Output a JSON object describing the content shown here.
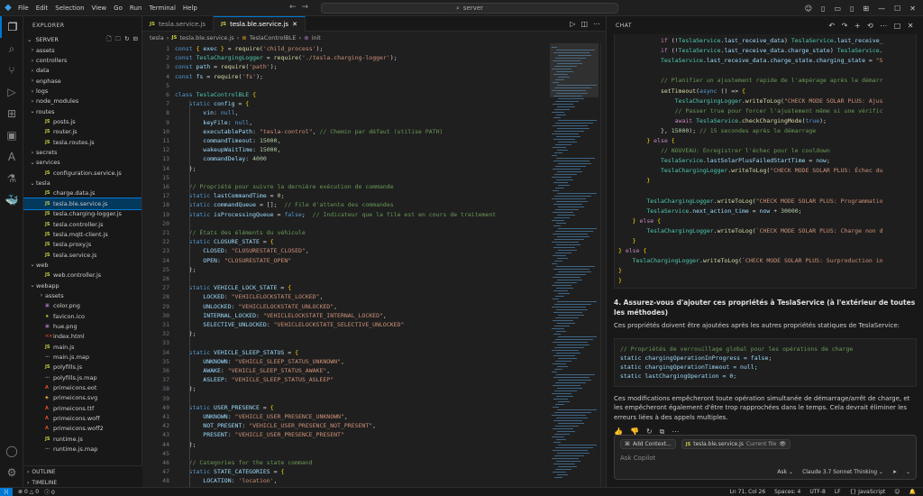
{
  "titlebar": {
    "menus": [
      "File",
      "Edit",
      "Selection",
      "View",
      "Go",
      "Run",
      "Terminal",
      "Help"
    ],
    "search": "server"
  },
  "explorer": {
    "header": "EXPLORER",
    "root": "SERVER",
    "tree": [
      {
        "name": "assets",
        "type": "folder",
        "depth": 1,
        "open": false
      },
      {
        "name": "controllers",
        "type": "folder",
        "depth": 1,
        "open": false
      },
      {
        "name": "data",
        "type": "folder",
        "depth": 1,
        "open": false
      },
      {
        "name": "enphase",
        "type": "folder",
        "depth": 1,
        "open": false
      },
      {
        "name": "logs",
        "type": "folder",
        "depth": 1,
        "open": false
      },
      {
        "name": "node_modules",
        "type": "folder",
        "depth": 1,
        "open": false
      },
      {
        "name": "routes",
        "type": "folder",
        "depth": 1,
        "open": true
      },
      {
        "name": "posts.js",
        "type": "js",
        "depth": 2
      },
      {
        "name": "router.js",
        "type": "js",
        "depth": 2
      },
      {
        "name": "tesla.routes.js",
        "type": "js",
        "depth": 2
      },
      {
        "name": "secrets",
        "type": "folder",
        "depth": 1,
        "open": false
      },
      {
        "name": "services",
        "type": "folder",
        "depth": 1,
        "open": true
      },
      {
        "name": "configuration.service.js",
        "type": "js",
        "depth": 2
      },
      {
        "name": "tesla",
        "type": "folder",
        "depth": 1,
        "open": true
      },
      {
        "name": "charge.data.js",
        "type": "js",
        "depth": 2
      },
      {
        "name": "tesla.ble.service.js",
        "type": "js",
        "depth": 2,
        "selected": true
      },
      {
        "name": "tesla.charging-logger.js",
        "type": "js",
        "depth": 2
      },
      {
        "name": "tesla.controller.js",
        "type": "js",
        "depth": 2
      },
      {
        "name": "tesla.mqtt-client.js",
        "type": "js",
        "depth": 2
      },
      {
        "name": "tesla.proxy.js",
        "type": "js",
        "depth": 2
      },
      {
        "name": "tesla.service.js",
        "type": "js",
        "depth": 2
      },
      {
        "name": "web",
        "type": "folder",
        "depth": 1,
        "open": true
      },
      {
        "name": "web.controller.js",
        "type": "js",
        "depth": 2
      },
      {
        "name": "webapp",
        "type": "folder",
        "depth": 1,
        "open": true
      },
      {
        "name": "assets",
        "type": "folder",
        "depth": 2,
        "open": false
      },
      {
        "name": "color.png",
        "type": "png",
        "depth": 2
      },
      {
        "name": "favicon.ico",
        "type": "ico",
        "depth": 2
      },
      {
        "name": "hue.png",
        "type": "png",
        "depth": 2
      },
      {
        "name": "index.html",
        "type": "html",
        "depth": 2
      },
      {
        "name": "main.js",
        "type": "js",
        "depth": 2
      },
      {
        "name": "main.js.map",
        "type": "map",
        "depth": 2
      },
      {
        "name": "polyfills.js",
        "type": "js",
        "depth": 2
      },
      {
        "name": "polyfills.js.map",
        "type": "map",
        "depth": 2
      },
      {
        "name": "primeicons.eot",
        "type": "eot",
        "depth": 2
      },
      {
        "name": "primeicons.svg",
        "type": "svg",
        "depth": 2
      },
      {
        "name": "primeicons.ttf",
        "type": "ttf",
        "depth": 2
      },
      {
        "name": "primeicons.woff",
        "type": "woff",
        "depth": 2
      },
      {
        "name": "primeicons.woff2",
        "type": "woff",
        "depth": 2
      },
      {
        "name": "runtime.js",
        "type": "js",
        "depth": 2
      },
      {
        "name": "runtime.js.map",
        "type": "map",
        "depth": 2
      }
    ],
    "outline": "OUTLINE",
    "timeline": "TIMELINE"
  },
  "editor": {
    "tabs": [
      {
        "label": "tesla.service.js",
        "active": false
      },
      {
        "label": "tesla.ble.service.js",
        "active": true
      }
    ],
    "breadcrumb": [
      "tesla",
      "tesla.ble.service.js",
      "TeslaControlBLE",
      "init"
    ],
    "line_numbers": [
      "1",
      "2",
      "3",
      "4",
      "5",
      "6",
      "7",
      "8",
      "9",
      "10",
      "11",
      "12",
      "13",
      "14",
      "15",
      "16",
      "17",
      "18",
      "19",
      "20",
      "21",
      "22",
      "23",
      "24",
      "25",
      "26",
      "27",
      "28",
      "29",
      "30",
      "31",
      "32",
      "33",
      "34",
      "35",
      "36",
      "37",
      "38",
      "39",
      "40",
      "41",
      "42",
      "43",
      "44",
      "45",
      "46",
      "47",
      "48"
    ],
    "code": [
      "const { exec } = require('child_process');",
      "const TeslaChargingLogger = require('./tesla.charging-logger');",
      "const path = require('path');",
      "const fs = require('fs');",
      "",
      "class TeslaControlBLE {",
      "    static config = {",
      "        vin: null,",
      "        keyFile: null,",
      "        executablePath: \"tesla-control\", // Chemin par défaut (utilise PATH)",
      "        commandTimeout: 15000,",
      "        wakeupWaitTime: 15000,",
      "        commandDelay: 4000",
      "    };",
      "",
      "    // Propriété pour suivre la dernière exécution de commande",
      "    static lastCommandTime = 0;",
      "    static commandQueue = [];  // File d'attente des commandes",
      "    static isProcessingQueue = false;  // Indicateur que la file est en cours de traitement",
      "",
      "    // États des éléments du véhicule",
      "    static CLOSURE_STATE = {",
      "        CLOSED: \"CLOSURESTATE_CLOSED\",",
      "        OPEN: \"CLOSURESTATE_OPEN\"",
      "    };",
      "",
      "    static VEHICLE_LOCK_STATE = {",
      "        LOCKED: \"VEHICLELOCKSTATE_LOCKED\",",
      "        UNLOCKED: \"VEHICLELOCKSTATE_UNLOCKED\",",
      "        INTERNAL_LOCKED: \"VEHICLELOCKSTATE_INTERNAL_LOCKED\",",
      "        SELECTIVE_UNLOCKED: \"VEHICLELOCKSTATE_SELECTIVE_UNLOCKED\"",
      "    };",
      "",
      "    static VEHICLE_SLEEP_STATUS = {",
      "        UNKNOWN: \"VEHICLE_SLEEP_STATUS_UNKNOWN\",",
      "        AWAKE: \"VEHICLE_SLEEP_STATUS_AWAKE\",",
      "        ASLEEP: \"VEHICLE_SLEEP_STATUS_ASLEEP\"",
      "    };",
      "",
      "    static USER_PRESENCE = {",
      "        UNKNOWN: \"VEHICLE_USER_PRESENCE_UNKNOWN\",",
      "        NOT_PRESENT: \"VEHICLE_USER_PRESENCE_NOT_PRESENT\",",
      "        PRESENT: \"VEHICLE_USER_PRESENCE_PRESENT\"",
      "    };",
      "",
      "    // Categories for the state command",
      "    static STATE_CATEGORIES = {",
      "        LOCATION: 'location',"
    ]
  },
  "chat": {
    "header": "CHAT",
    "code": [
      "            if (!TeslaService.last_receive_data) TeslaService.last_receive_",
      "            if (!TeslaService.last_receive_data.charge_state) TeslaService.",
      "            TeslaService.last_receive_data.charge_state.charging_state = \"S",
      "",
      "            // Planifier un ajustement rapide de l'ampérage après le démarr",
      "            setTimeout(async () => {",
      "                TeslaChargingLogger.writeToLog(\"CHECK MODE SOLAR PLUS: Ajus",
      "                // Passer true pour forcer l'ajustement même si une vérific",
      "                await TeslaService.checkChargingMode(true);",
      "            }, 15000); // 15 secondes après le démarrage",
      "        } else {",
      "            // NOUVEAU: Enregistrer l'échec pour le cooldown",
      "            TeslaService.lastSolarPlusFailedStartTime = now;",
      "            TeslaChargingLogger.writeToLog(\"CHECK MODE SOLAR PLUS: Échec du",
      "        }",
      "",
      "        TeslaChargingLogger.writeToLog(\"CHECK MODE SOLAR PLUS: Programmatio",
      "        TeslaService.next_action_time = now + 30000;",
      "    } else {",
      "        TeslaChargingLogger.writeToLog(`CHECK MODE SOLAR PLUS: Charge non d",
      "    }",
      "} else {",
      "    TeslaChargingLogger.writeToLog(`CHECK MODE SOLAR PLUS: Surproduction in",
      "}",
      "}"
    ],
    "heading": "4. Assurez-vous d'ajouter ces propriétés à TeslaService (à l'extérieur de toutes les méthodes)",
    "intro": "Ces propriétés doivent être ajoutées après les autres propriétés statiques de TeslaService:",
    "snippet": [
      "// Propriétés de verrouillage global pour les opérations de charge",
      "static chargingOperationInProgress = false;",
      "static chargingOperationTimeout = null;",
      "static lastChargingOperation = 0;"
    ],
    "conclusion": "Ces modifications empêcheront toute opération simultanée de démarrage/arrêt de charge, et les empêcheront également d'être trop rapprochées dans le temps. Cela devrait éliminer les erreurs liées à des appels multiples.",
    "input": {
      "add_context": "Add Context...",
      "current_file": "tesla.ble.service.js",
      "current_file_tag": "Current file",
      "placeholder": "Ask Copilot",
      "mode": "Ask",
      "model": "Claude 3.7 Sonnet Thinking"
    }
  },
  "statusbar": {
    "problems": "0",
    "warnings": "0",
    "info": "0",
    "position": "Ln 71, Col 26",
    "spaces": "Spaces: 4",
    "encoding": "UTF-8",
    "eol": "LF",
    "language": "JavaScript"
  }
}
